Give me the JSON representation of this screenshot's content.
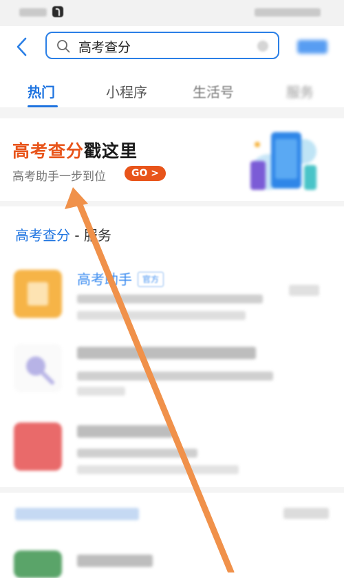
{
  "search": {
    "query": "高考查分"
  },
  "tabs": [
    {
      "label": "热门"
    },
    {
      "label": "小程序"
    },
    {
      "label": "生活号"
    },
    {
      "label": "服务"
    }
  ],
  "banner": {
    "title_highlight": "高考查分",
    "title_rest": "戳这里",
    "subtitle": "高考助手一步到位",
    "go_label": "GO >"
  },
  "section": {
    "keyword": "高考查分",
    "suffix": " - 服务"
  },
  "items": [
    {
      "name": "高考助手",
      "tag": "官方"
    }
  ],
  "colors": {
    "accent_blue": "#1f74e0",
    "accent_orange": "#e8541a",
    "annotation_arrow": "#f0914a"
  },
  "icons": [
    "back-icon",
    "search-icon",
    "clear-icon"
  ]
}
